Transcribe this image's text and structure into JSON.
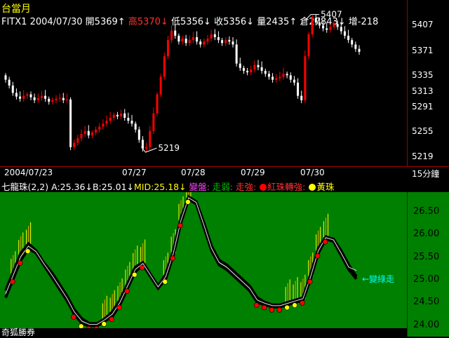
{
  "header": {
    "period": "台當月",
    "symbol": "FITX1",
    "date": "2004/07/30",
    "open_label": "開",
    "open": "5369↑",
    "high_label": "高",
    "high": "5370↓",
    "low_label": "低",
    "low": "5356↓",
    "close_label": "收",
    "close": "5356↓",
    "volume_label": "量",
    "volume": "2435↑",
    "oi_label": "倉",
    "oi": "27843↓",
    "change_label": "增",
    "change": "-218"
  },
  "price_axis": [
    "5407",
    "5371",
    "5335",
    "5313",
    "5291",
    "5255",
    "5219"
  ],
  "annotations": {
    "high": "5407",
    "low": "5219"
  },
  "date_strip": {
    "labels": [
      "2004/07/23",
      "07/27",
      "07/28",
      "07/29",
      "07/30"
    ],
    "interval": "15分鐘"
  },
  "indicator_header": {
    "name": "七龍珠(2,2)",
    "a_label": "A:",
    "a_value": "25.36↓",
    "b_label": "B:",
    "b_value": "25.01↓",
    "mid_label": "MID:",
    "mid_value": "25.18↓",
    "legend_change": "變盤:",
    "legend_weak": "走弱:",
    "legend_strong": "走強:",
    "legend_red": "紅珠轉強:",
    "legend_yellow": "黃珠"
  },
  "indicator_axis": [
    "26.50",
    "26.00",
    "25.50",
    "25.00",
    "24.50",
    "24.00"
  ],
  "indicator_note": "←變綠走",
  "footer": {
    "brand": "奇狐勝券"
  },
  "colors": {
    "background": "#000000",
    "up_candle": "#ff0000",
    "down_candle": "#ffffff",
    "indicator_bg": "#008000",
    "red_bead": "#ff0000",
    "yellow_bead": "#ffff00",
    "accent_cyan": "#00ffff"
  },
  "chart_data": [
    {
      "type": "candlestick",
      "title": "台當月 FITX1",
      "ylim": [
        5200,
        5420
      ],
      "y_ticks": [
        5407,
        5371,
        5335,
        5313,
        5291,
        5255,
        5219
      ],
      "x_labels": [
        "2004/07/23",
        "07/27",
        "07/28",
        "07/29",
        "07/30"
      ],
      "closes": [
        5318,
        5310,
        5300,
        5295,
        5292,
        5296,
        5298,
        5294,
        5290,
        5293,
        5296,
        5292,
        5288,
        5290,
        5292,
        5293,
        5290,
        5291,
        5226,
        5232,
        5238,
        5244,
        5248,
        5242,
        5246,
        5250,
        5254,
        5258,
        5262,
        5266,
        5270,
        5268,
        5272,
        5266,
        5262,
        5258,
        5250,
        5236,
        5224,
        5226,
        5248,
        5272,
        5298,
        5322,
        5350,
        5372,
        5385,
        5378,
        5370,
        5374,
        5368,
        5372,
        5376,
        5370,
        5366,
        5370,
        5374,
        5380,
        5376,
        5372,
        5368,
        5372,
        5370,
        5366,
        5340,
        5334,
        5330,
        5328,
        5332,
        5338,
        5335,
        5330,
        5326,
        5322,
        5318,
        5320,
        5322,
        5326,
        5324,
        5318,
        5314,
        5296,
        5290,
        5350,
        5380,
        5402,
        5396,
        5392,
        5388,
        5386,
        5390,
        5394,
        5390,
        5384,
        5378,
        5372,
        5366,
        5360,
        5356
      ],
      "high": 5407,
      "low": 5219
    },
    {
      "type": "line",
      "title": "七龍珠(2,2)",
      "ylim": [
        23.95,
        26.85
      ],
      "y_ticks": [
        26.5,
        26.0,
        25.5,
        25.0,
        24.5,
        24.0
      ],
      "series": [
        {
          "name": "A",
          "values": [
            24.75,
            25.15,
            25.55,
            25.75,
            25.6,
            25.35,
            25.15,
            24.9,
            24.65,
            24.35,
            24.15,
            24.05,
            24.05,
            24.15,
            24.3,
            24.55,
            24.9,
            25.25,
            25.35,
            25.1,
            24.85,
            25.1,
            25.6,
            26.3,
            26.75,
            26.65,
            26.2,
            25.7,
            25.4,
            25.3,
            25.15,
            25.0,
            24.85,
            24.6,
            24.5,
            24.45,
            24.45,
            24.5,
            24.55,
            24.6,
            25.1,
            25.65,
            25.9,
            25.85,
            25.6,
            25.3,
            25.05
          ]
        },
        {
          "name": "B",
          "values": [
            24.6,
            25.0,
            25.4,
            25.65,
            25.55,
            25.3,
            25.05,
            24.8,
            24.55,
            24.25,
            24.05,
            24.0,
            24.0,
            24.1,
            24.2,
            24.45,
            24.8,
            25.15,
            25.3,
            25.05,
            24.8,
            25.0,
            25.5,
            26.2,
            26.7,
            26.6,
            26.1,
            25.6,
            25.3,
            25.2,
            25.05,
            24.9,
            24.75,
            24.5,
            24.45,
            24.4,
            24.4,
            24.45,
            24.5,
            24.55,
            25.0,
            25.55,
            25.85,
            25.8,
            25.5,
            25.2,
            25.0
          ]
        },
        {
          "name": "MID",
          "values": [
            24.68,
            25.08,
            25.48,
            25.7,
            25.58,
            25.33,
            25.1,
            24.85,
            24.6,
            24.3,
            24.1,
            24.03,
            24.03,
            24.13,
            24.25,
            24.5,
            24.85,
            25.2,
            25.33,
            25.08,
            24.83,
            25.05,
            25.55,
            26.25,
            26.73,
            26.63,
            26.15,
            25.65,
            25.35,
            25.25,
            25.1,
            24.95,
            24.8,
            24.55,
            24.48,
            24.43,
            24.43,
            24.48,
            24.53,
            24.58,
            25.05,
            25.6,
            25.88,
            25.83,
            25.55,
            25.25,
            25.18
          ]
        }
      ]
    }
  ]
}
